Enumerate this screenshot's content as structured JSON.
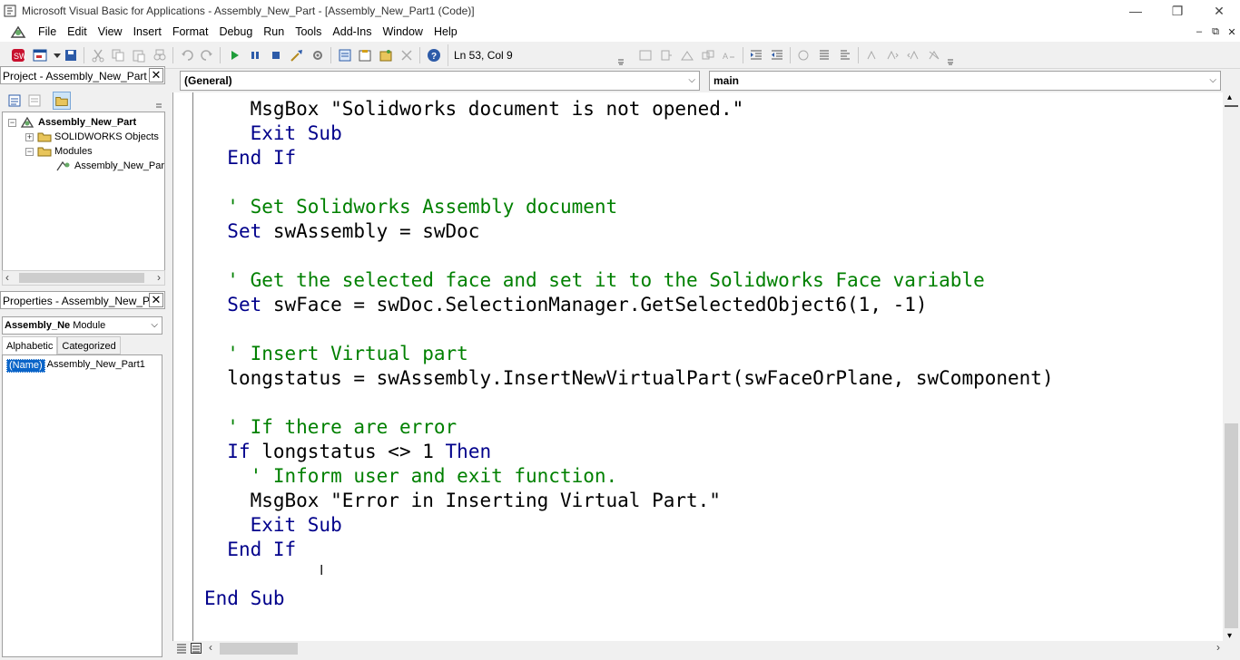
{
  "window": {
    "title": "Microsoft Visual Basic for Applications - Assembly_New_Part - [Assembly_New_Part1 (Code)]",
    "controls": [
      "—",
      "❐",
      "✕"
    ]
  },
  "menu": {
    "items": [
      "File",
      "Edit",
      "View",
      "Insert",
      "Format",
      "Debug",
      "Run",
      "Tools",
      "Add-Ins",
      "Window",
      "Help"
    ],
    "mdi_controls": [
      "–",
      "⧉",
      "✕"
    ]
  },
  "toolbar": {
    "position": "Ln 53, Col 9"
  },
  "project": {
    "title": "Project - Assembly_New_Part",
    "root": "Assembly_New_Part",
    "folder1": "SOLIDWORKS Objects",
    "folder2": "Modules",
    "module": "Assembly_New_Part"
  },
  "properties": {
    "title": "Properties - Assembly_New_Pa",
    "object_name": "Assembly_Ne",
    "object_type": "Module",
    "tab_alpha": "Alphabetic",
    "tab_cat": "Categorized",
    "prop_name": "(Name)",
    "prop_value": "Assembly_New_Part1"
  },
  "code": {
    "object_combo": "(General)",
    "proc_combo": "main",
    "lines": [
      {
        "indent": "    ",
        "parts": [
          [
            "",
            "MsgBox \"Solidworks document is not opened.\""
          ]
        ]
      },
      {
        "indent": "    ",
        "parts": [
          [
            "kw",
            "Exit Sub"
          ]
        ]
      },
      {
        "indent": "  ",
        "parts": [
          [
            "kw",
            "End If"
          ]
        ]
      },
      {
        "indent": "",
        "parts": []
      },
      {
        "indent": "  ",
        "parts": [
          [
            "cm",
            "' Set Solidworks Assembly document"
          ]
        ]
      },
      {
        "indent": "  ",
        "parts": [
          [
            "kw",
            "Set"
          ],
          [
            "",
            " swAssembly = swDoc"
          ]
        ]
      },
      {
        "indent": "",
        "parts": []
      },
      {
        "indent": "  ",
        "parts": [
          [
            "cm",
            "' Get the selected face and set it to the Solidworks Face variable"
          ]
        ]
      },
      {
        "indent": "  ",
        "parts": [
          [
            "kw",
            "Set"
          ],
          [
            "",
            " swFace = swDoc.SelectionManager.GetSelectedObject6(1, -1)"
          ]
        ]
      },
      {
        "indent": "",
        "parts": []
      },
      {
        "indent": "  ",
        "parts": [
          [
            "cm",
            "' Insert Virtual part"
          ]
        ]
      },
      {
        "indent": "  ",
        "parts": [
          [
            "",
            "longstatus = swAssembly.InsertNewVirtualPart(swFaceOrPlane, swComponent)"
          ]
        ]
      },
      {
        "indent": "",
        "parts": []
      },
      {
        "indent": "  ",
        "parts": [
          [
            "cm",
            "' If there are error"
          ]
        ]
      },
      {
        "indent": "  ",
        "parts": [
          [
            "kw",
            "If"
          ],
          [
            "",
            " longstatus <> 1 "
          ],
          [
            "kw",
            "Then"
          ]
        ]
      },
      {
        "indent": "    ",
        "parts": [
          [
            "cm",
            "' Inform user and exit function."
          ]
        ]
      },
      {
        "indent": "    ",
        "parts": [
          [
            "",
            "MsgBox \"Error in Inserting Virtual Part.\""
          ]
        ]
      },
      {
        "indent": "    ",
        "parts": [
          [
            "kw",
            "Exit Sub"
          ]
        ]
      },
      {
        "indent": "  ",
        "parts": [
          [
            "kw",
            "End If"
          ]
        ]
      },
      {
        "indent": "",
        "parts": []
      },
      {
        "indent": "",
        "parts": [
          [
            "kw",
            "End Sub"
          ]
        ]
      }
    ]
  }
}
